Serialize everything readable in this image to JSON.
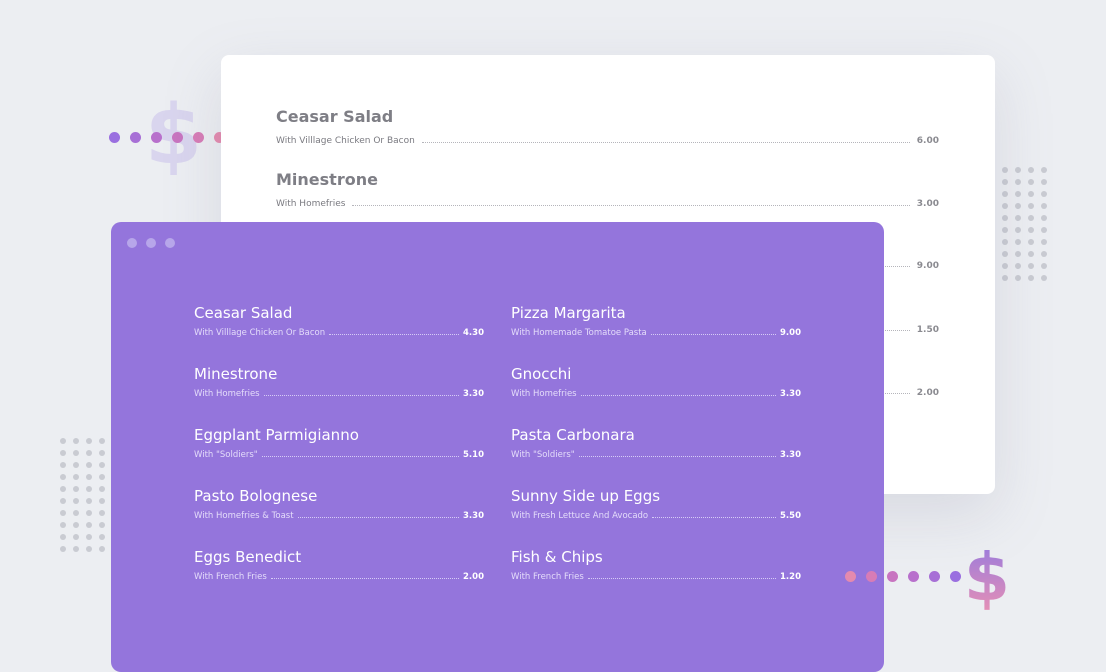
{
  "decor": {
    "dollar_left": "$",
    "dollar_right": "$",
    "dots_left_colors": [
      "#9a6fe0",
      "#a76fd6",
      "#b870cc",
      "#c874c0",
      "#d77cb6",
      "#e48aae"
    ],
    "dots_right_colors": [
      "#e48aae",
      "#d77cb6",
      "#c874c0",
      "#b870cc",
      "#a76fd6",
      "#9a6fe0"
    ]
  },
  "back_menu": {
    "items": [
      {
        "name": "Ceasar Salad",
        "desc": "With Villlage Chicken Or Bacon",
        "price": "6.00"
      },
      {
        "name": "Minestrone",
        "desc": "With Homefries",
        "price": "3.00"
      }
    ],
    "partial_prices": [
      "9.00",
      "1.50",
      "2.00"
    ]
  },
  "front_menu": {
    "left": [
      {
        "name": "Ceasar Salad",
        "desc": "With Villlage Chicken Or Bacon",
        "price": "4.30"
      },
      {
        "name": "Minestrone",
        "desc": "With Homefries",
        "price": "3.30"
      },
      {
        "name": "Eggplant Parmigianno",
        "desc": "With \"Soldiers\"",
        "price": "5.10"
      },
      {
        "name": "Pasto Bolognese",
        "desc": "With Homefries & Toast",
        "price": "3.30"
      },
      {
        "name": "Eggs Benedict",
        "desc": "With French Fries",
        "price": "2.00"
      }
    ],
    "right": [
      {
        "name": "Pizza Margarita",
        "desc": "With Homemade Tomatoe Pasta",
        "price": "9.00"
      },
      {
        "name": "Gnocchi",
        "desc": "With Homefries",
        "price": "3.30"
      },
      {
        "name": "Pasta Carbonara",
        "desc": "With \"Soldiers\"",
        "price": "3.30"
      },
      {
        "name": "Sunny Side up Eggs",
        "desc": "With Fresh Lettuce And Avocado",
        "price": "5.50"
      },
      {
        "name": "Fish & Chips",
        "desc": "With French Fries",
        "price": "1.20"
      }
    ]
  }
}
